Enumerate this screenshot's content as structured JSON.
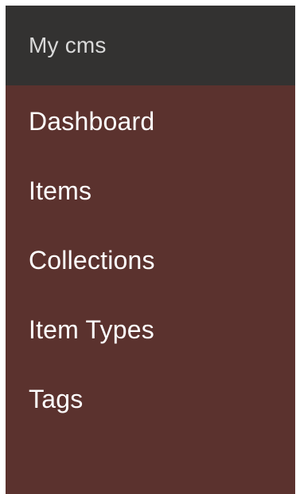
{
  "header": {
    "title": "My cms"
  },
  "nav": {
    "items": [
      {
        "label": "Dashboard"
      },
      {
        "label": "Items"
      },
      {
        "label": "Collections"
      },
      {
        "label": "Item Types"
      },
      {
        "label": "Tags"
      }
    ]
  },
  "colors": {
    "header_bg": "#333231",
    "sidebar_bg": "#5b322e",
    "header_text": "#d9d9d9",
    "nav_text": "#ffffff"
  }
}
